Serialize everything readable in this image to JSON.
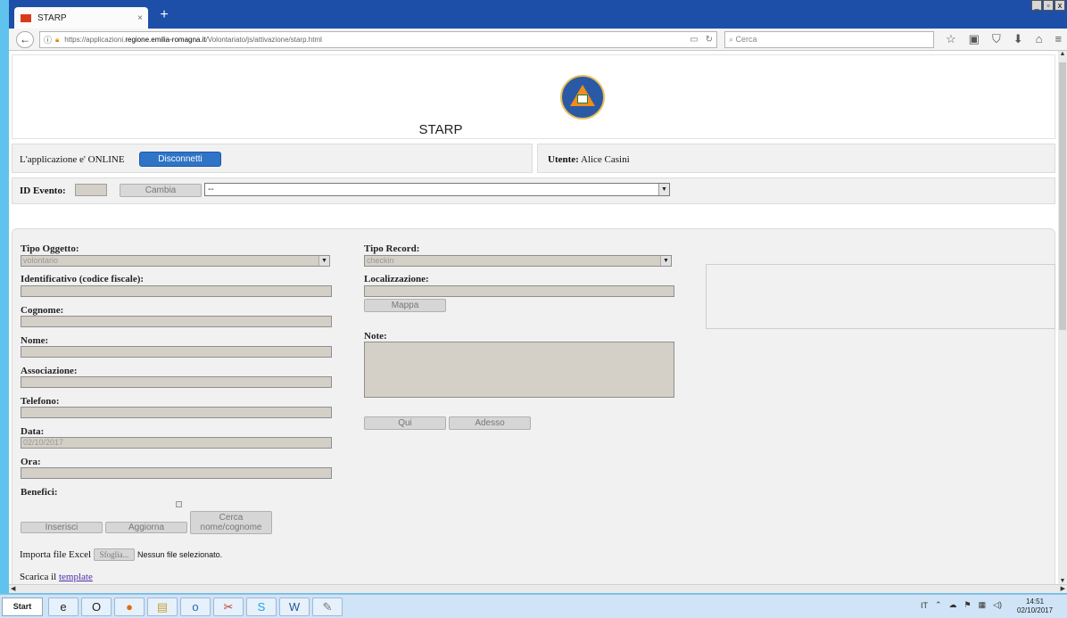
{
  "browser": {
    "tab_title": "STARP",
    "tab_close": "×",
    "new_tab": "+",
    "url_prefix": "https://applicazioni.",
    "url_domain": "regione.emilia-romagna.it",
    "url_path": "/Volontariato/js/attivazione/starp.html",
    "search_placeholder": "Cerca",
    "back_symbol": "←",
    "window_controls": [
      "_",
      "▫",
      "x"
    ],
    "toolbar_icons": [
      "star-icon",
      "reading-list-icon",
      "pocket-icon",
      "download-icon",
      "home-icon",
      "menu-icon"
    ],
    "toolbar_glyphs": [
      "☆",
      "▣",
      "⛉",
      "⬇",
      "⌂",
      "≡"
    ]
  },
  "header": {
    "title": "STARP",
    "logo": "protezione-civile-logo"
  },
  "status": {
    "online_text": "L'applicazione e' ONLINE",
    "disconnect_label": "Disconnetti",
    "user_label": "Utente:",
    "user_name": "Alice Casini"
  },
  "event": {
    "id_label": "ID Evento:",
    "id_value": "",
    "change_label": "Cambia",
    "select_value": "--"
  },
  "form": {
    "tipo_oggetto_label": "Tipo Oggetto:",
    "tipo_oggetto_value": "volontario",
    "identificativo_label": "Identificativo (codice fiscale):",
    "identificativo_value": "",
    "cognome_label": "Cognome:",
    "cognome_value": "",
    "nome_label": "Nome:",
    "nome_value": "",
    "associazione_label": "Associazione:",
    "associazione_value": "",
    "telefono_label": "Telefono:",
    "telefono_value": "",
    "data_label": "Data:",
    "data_value": "02/10/2017",
    "ora_label": "Ora:",
    "ora_value": "",
    "benefici_label": "Benefici:",
    "tipo_record_label": "Tipo Record:",
    "tipo_record_value": "checkin",
    "localizzazione_label": "Localizzazione:",
    "localizzazione_value": "",
    "mappa_label": "Mappa",
    "note_label": "Note:",
    "qui_label": "Qui",
    "adesso_label": "Adesso",
    "inserisci_label": "Inserisci",
    "aggiorna_label": "Aggiorna",
    "cerca_label_1": "Cerca",
    "cerca_label_2": "nome/cognome",
    "import_label": "Importa file Excel",
    "browse_label": "Sfoglia...",
    "no_file_label": "Nessun file selezionato.",
    "download_prefix": "Scarica il",
    "template_link": "template"
  },
  "taskbar": {
    "start_label": "Start",
    "apps": [
      "ie-icon",
      "outlook-icon",
      "firefox-icon",
      "explorer-icon",
      "outlook-mail-icon",
      "snipping-icon",
      "skype-icon",
      "word-icon",
      "paint-icon"
    ],
    "app_glyphs": [
      "e",
      "O",
      "●",
      "▤",
      "o",
      "✂",
      "S",
      "W",
      "✎"
    ],
    "lang": "IT",
    "tray_glyphs": [
      "⌃",
      "☁",
      "⚑",
      "▦",
      "◁)"
    ],
    "time": "14:51",
    "date": "02/10/2017"
  }
}
